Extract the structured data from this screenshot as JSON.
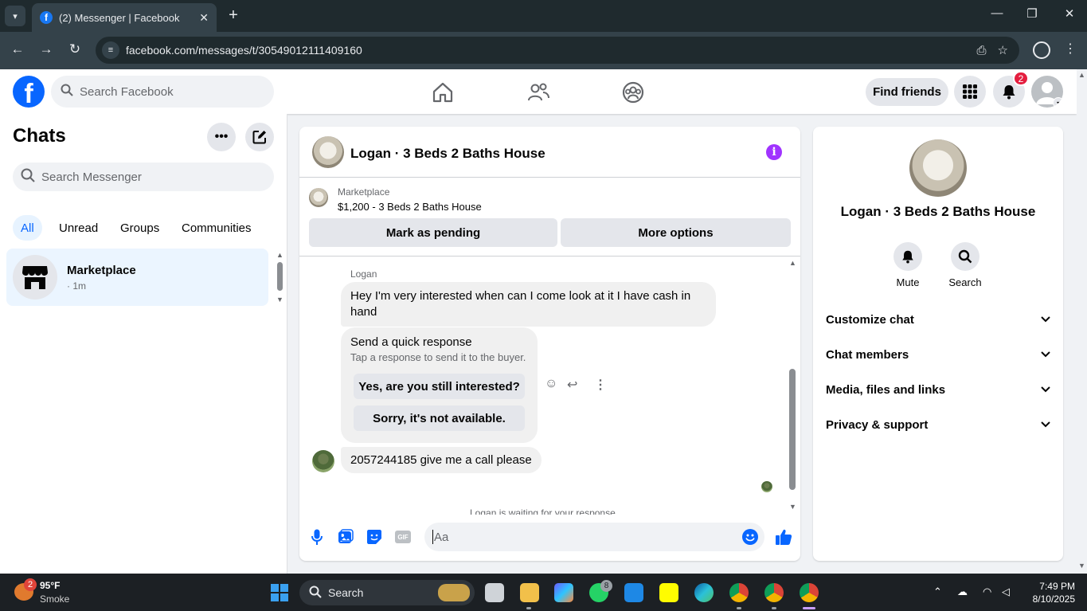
{
  "browser": {
    "tab_title": "(2) Messenger | Facebook",
    "url": "facebook.com/messages/t/30549012111409160"
  },
  "header": {
    "search_placeholder": "Search Facebook",
    "find_friends_label": "Find friends",
    "notification_count": "2"
  },
  "sidebar": {
    "title": "Chats",
    "search_placeholder": "Search Messenger",
    "filters": [
      "All",
      "Unread",
      "Groups",
      "Communities"
    ],
    "active_filter": "All",
    "chats": [
      {
        "name": "Marketplace",
        "time": "· 1m"
      }
    ]
  },
  "conversation": {
    "title": "Logan · 3 Beds 2 Baths House",
    "marketplace_label": "Marketplace",
    "listing": "$1,200 - 3 Beds 2 Baths House",
    "mark_pending_label": "Mark as pending",
    "more_options_label": "More options",
    "sender_name": "Logan",
    "messages": [
      {
        "text": "Hey I'm very interested when can I come look at it I have cash in hand"
      },
      {
        "text": "2057244185 give me a call please"
      }
    ],
    "quick_response": {
      "title": "Send a quick response",
      "subtitle": "Tap a response to send it to the buyer.",
      "options": [
        "Yes, are you still interested?",
        "Sorry, it's not available."
      ]
    },
    "waiting_text": "Logan is waiting for your response",
    "composer_placeholder": "Aa",
    "gif_label": "GIF"
  },
  "info_panel": {
    "name": "Logan · 3 Beds 2 Baths House",
    "actions": [
      "Mute",
      "Search"
    ],
    "sections": [
      "Customize chat",
      "Chat members",
      "Media, files and links",
      "Privacy & support"
    ]
  },
  "taskbar": {
    "weather_temp": "95°F",
    "weather_desc": "Smoke",
    "weather_badge": "2",
    "search_label": "Search",
    "whatsapp_badge": "8",
    "time": "7:49 PM",
    "date": "8/10/2025"
  },
  "colors": {
    "facebook_blue": "#0866ff",
    "notification_red": "#e41e3f",
    "info_purple": "#a033ff",
    "selected_chat_bg": "#ebf5ff"
  }
}
